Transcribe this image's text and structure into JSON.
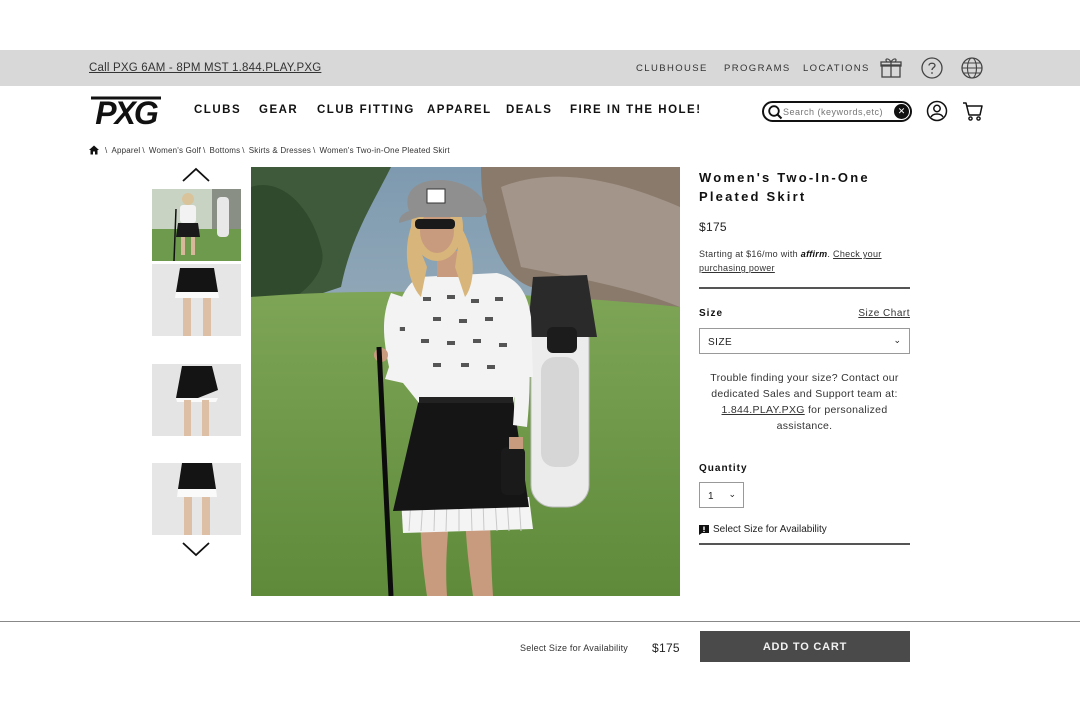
{
  "utility_bar": {
    "call_text": "Call PXG 6AM - 8PM MST 1.844.PLAY.PXG",
    "links": [
      "CLUBHOUSE",
      "PROGRAMS",
      "LOCATIONS"
    ],
    "icons": [
      "gift-icon",
      "help-icon",
      "globe-icon"
    ]
  },
  "header": {
    "logo_text": "PXG",
    "nav": [
      "CLUBS",
      "GEAR",
      "CLUB FITTING",
      "APPAREL",
      "DEALS",
      "FIRE IN THE HOLE!"
    ],
    "search_placeholder": "Search (keywords,etc)",
    "icons": [
      "account-icon",
      "cart-icon"
    ]
  },
  "breadcrumb": [
    "Apparel",
    "Women's Golf",
    "Bottoms",
    "Skirts & Dresses",
    "Women's Two-in-One Pleated Skirt"
  ],
  "gallery": {
    "thumbnails": 4,
    "main_image": "woman-golfer-photo"
  },
  "product": {
    "title": "Women's Two-In-One Pleated Skirt",
    "price": "$175",
    "affirm_prefix": "Starting at $16/mo with",
    "affirm_brand": "affirm",
    "affirm_link": "Check your purchasing power",
    "size_label": "Size",
    "size_chart_label": "Size Chart",
    "size_value": "SIZE",
    "help_text": "Trouble finding your size? Contact our dedicated Sales and Support team at:",
    "help_phone": "1.844.PLAY.PXG",
    "help_suffix": "for personalized assistance.",
    "quantity_label": "Quantity",
    "quantity_value": "1",
    "availability_text": "Select Size for Availability"
  },
  "sticky_bar": {
    "message": "Select Size for Availability",
    "price": "$175",
    "button_label": "ADD TO CART"
  },
  "colors": {
    "utility_bar_bg": "#d8d8d8",
    "button_bg": "#4a4a4a"
  }
}
